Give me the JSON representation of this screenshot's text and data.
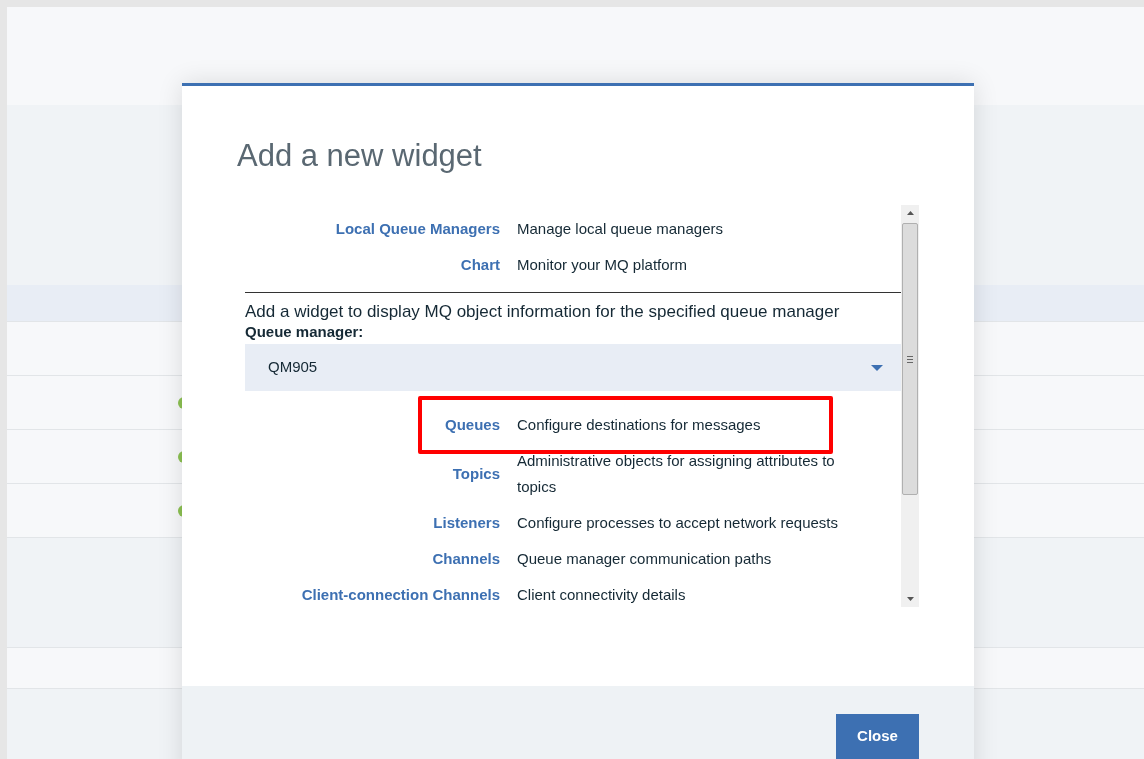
{
  "dialog": {
    "title": "Add a new widget",
    "general_widgets": [
      {
        "name": "Local Queue Managers",
        "description": "Manage local queue managers"
      },
      {
        "name": "Chart",
        "description": "Monitor your MQ platform"
      }
    ],
    "section_intro": "Add a widget to display MQ object information for the specified queue manager",
    "queue_manager_label": "Queue manager:",
    "queue_manager": {
      "value": "QM905"
    },
    "object_widgets": [
      {
        "name": "Queues",
        "description": "Configure destinations for messages",
        "highlighted": true
      },
      {
        "name": "Topics",
        "description": "Administrative objects for assigning attributes to topics",
        "highlighted": false
      },
      {
        "name": "Listeners",
        "description": "Configure processes to accept network requests",
        "highlighted": false
      },
      {
        "name": "Channels",
        "description": "Queue manager communication paths",
        "highlighted": false
      },
      {
        "name": "Client-connection Channels",
        "description": "Client connectivity details",
        "highlighted": false
      }
    ],
    "close_button": "Close"
  }
}
